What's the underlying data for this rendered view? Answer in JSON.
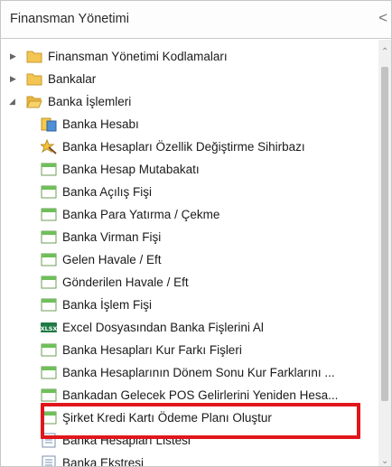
{
  "header": {
    "title": "Finansman Yönetimi",
    "collapse_glyph": "<"
  },
  "tree": {
    "roots": [
      {
        "label": "Finansman Yönetimi Kodlamaları",
        "expanded": false,
        "icon": "folder-icon"
      },
      {
        "label": "Bankalar",
        "expanded": false,
        "icon": "folder-icon"
      },
      {
        "label": "Banka İşlemleri",
        "expanded": true,
        "icon": "folder-open-icon"
      }
    ],
    "children": [
      {
        "label": "Banka Hesabı",
        "icon": "bank-account-icon"
      },
      {
        "label": "Banka Hesapları Özellik Değiştirme Sihirbazı",
        "icon": "wizard-icon"
      },
      {
        "label": "Banka Hesap Mutabakatı",
        "icon": "form-icon"
      },
      {
        "label": "Banka Açılış Fişi",
        "icon": "form-icon"
      },
      {
        "label": "Banka Para Yatırma / Çekme",
        "icon": "form-icon"
      },
      {
        "label": "Banka Virman Fişi",
        "icon": "form-icon"
      },
      {
        "label": "Gelen Havale / Eft",
        "icon": "form-icon"
      },
      {
        "label": "Gönderilen Havale / Eft",
        "icon": "form-icon"
      },
      {
        "label": "Banka İşlem Fişi",
        "icon": "form-icon"
      },
      {
        "label": "Excel Dosyasından Banka Fişlerini Al",
        "icon": "excel-icon"
      },
      {
        "label": "Banka Hesapları Kur Farkı Fişleri",
        "icon": "form-icon"
      },
      {
        "label": "Banka Hesaplarının Dönem Sonu Kur Farklarını ...",
        "icon": "form-icon"
      },
      {
        "label": "Bankadan Gelecek POS Gelirlerini Yeniden Hesa...",
        "icon": "form-icon"
      },
      {
        "label": "Şirket Kredi Kartı Ödeme Planı Oluştur",
        "icon": "form-icon"
      },
      {
        "label": "Banka Hesapları Listesi",
        "icon": "list-icon"
      },
      {
        "label": "Banka Ekstresi",
        "icon": "list-icon"
      }
    ]
  },
  "colors": {
    "highlight": "#e0161b",
    "folder": "#f3c553",
    "form_green": "#6fbf5a"
  }
}
